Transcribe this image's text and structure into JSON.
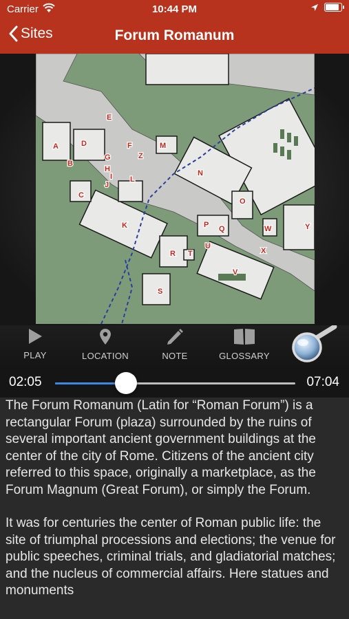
{
  "status": {
    "carrier": "Carrier",
    "time": "10:44 PM",
    "battery_level": 0.95
  },
  "nav": {
    "back_label": "Sites",
    "title": "Forum Romanum"
  },
  "map": {
    "labels": [
      "A",
      "B",
      "C",
      "D",
      "E",
      "F",
      "Z",
      "M",
      "G",
      "H",
      "I",
      "J",
      "L",
      "N",
      "O",
      "K",
      "P",
      "Q",
      "W",
      "Y",
      "X",
      "U",
      "R",
      "T",
      "V",
      "S"
    ]
  },
  "toolbar": {
    "items": [
      {
        "label": "PLAY",
        "icon": "play-icon"
      },
      {
        "label": "LOCATION",
        "icon": "location-pin-icon"
      },
      {
        "label": "NOTE",
        "icon": "pencil-icon"
      },
      {
        "label": "GLOSSARY",
        "icon": "book-icon"
      }
    ],
    "magnifier_icon": "magnifier-icon"
  },
  "player": {
    "current_time": "02:05",
    "duration": "07:04",
    "progress": 0.295
  },
  "description": {
    "paragraphs": [
      "The Forum Romanum (Latin for “Roman Forum”) is a rectangular Forum (plaza) surrounded by the ruins of several important ancient government buildings at the center of the city of Rome. Citizens of the ancient city referred to this space, originally a marketplace, as the Forum Magnum (Great Forum), or simply the Forum.",
      "It was for centuries the center of Roman public life: the site of triumphal processions and elections; the venue for public speeches, criminal trials, and gladiatorial matches; and the nucleus of commercial affairs. Here statues and monuments"
    ]
  },
  "colors": {
    "header": "#b8331e",
    "accent": "#3d8ae6",
    "map_green": "#7d9b78",
    "label_red": "#c0281e"
  }
}
